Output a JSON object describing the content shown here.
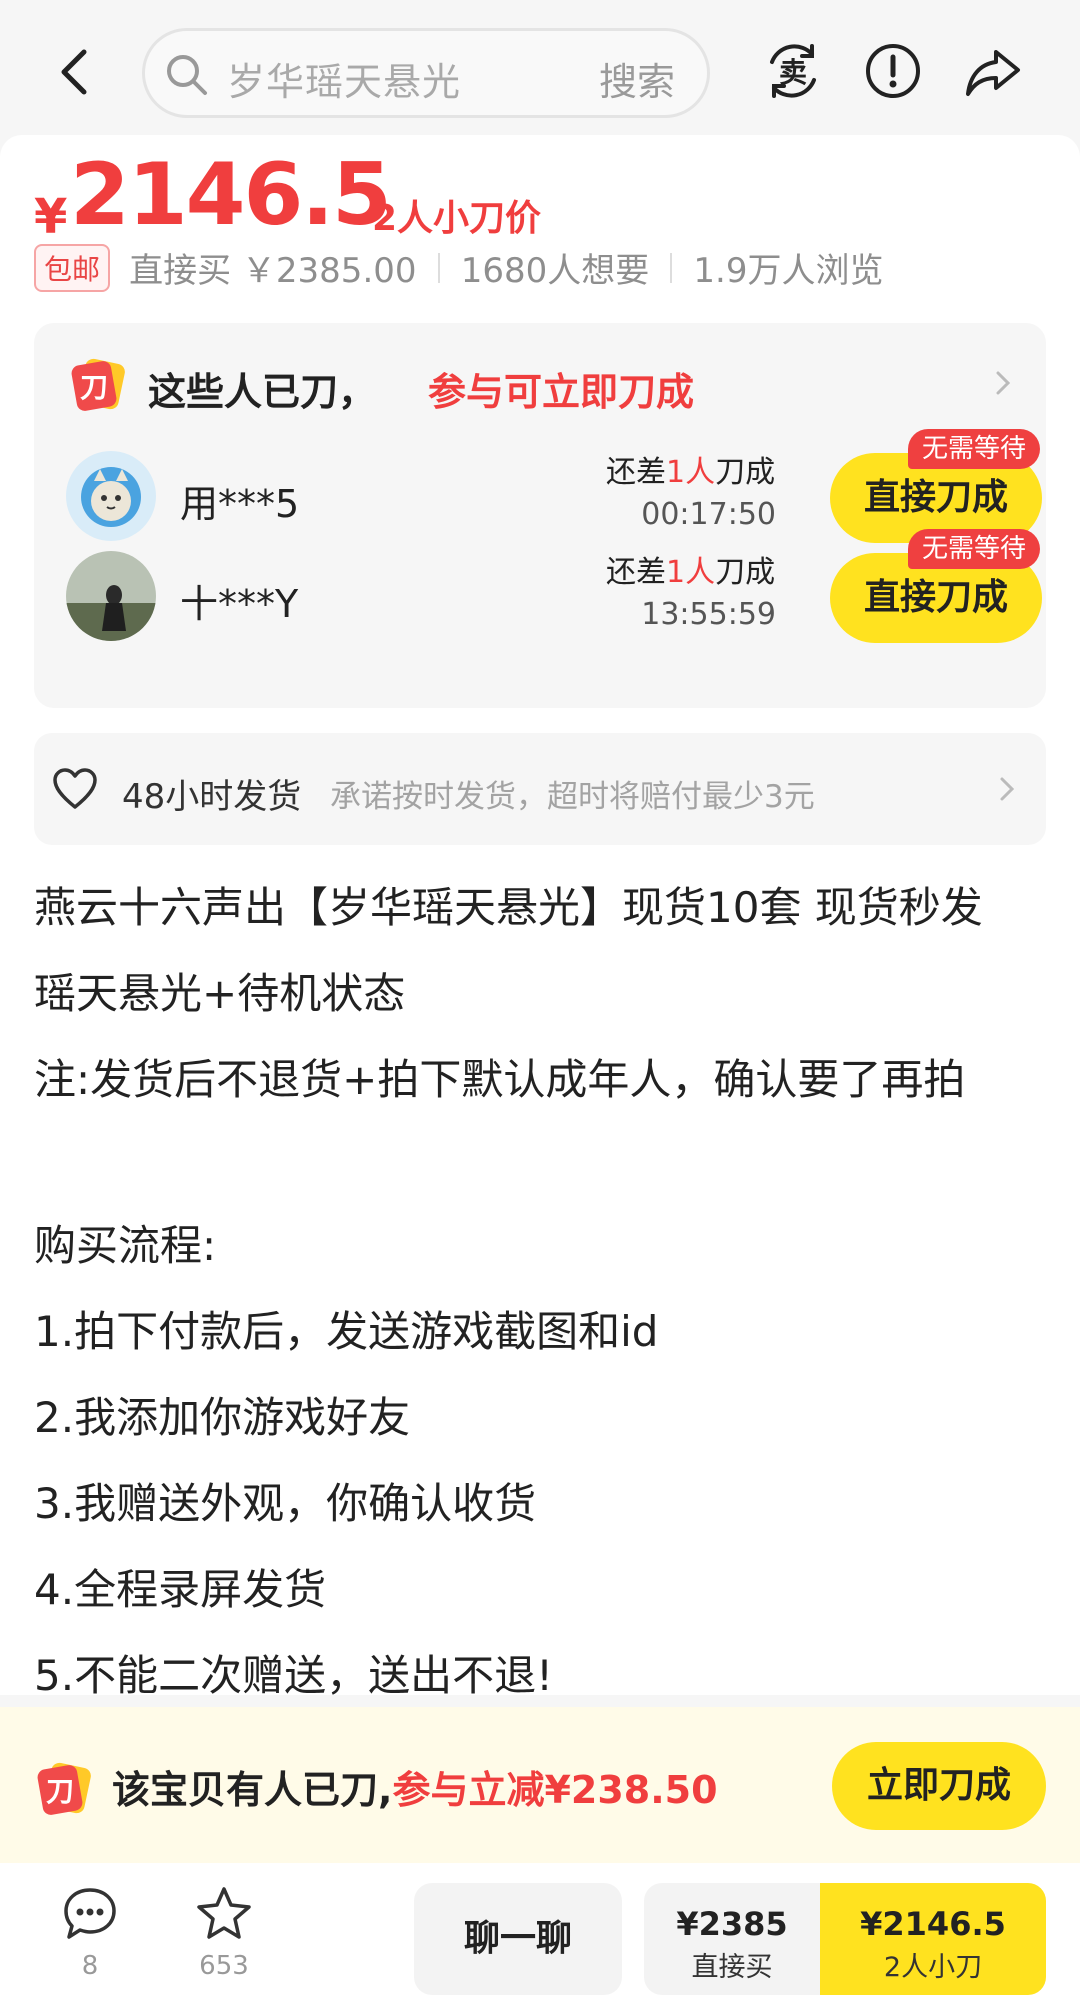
{
  "search": {
    "query": "岁华瑶天悬光",
    "button_label": "搜索"
  },
  "header_icons": [
    "back-arrow-icon",
    "sell-icon",
    "report-icon",
    "share-icon"
  ],
  "price": {
    "currency_symbol": "¥",
    "value": "2146.5",
    "tag": "2人小刀价"
  },
  "meta": {
    "free_shipping": "包邮",
    "direct_buy": "直接买 ￥2385.00",
    "wants": "1680人想要",
    "views": "1.9万人浏览"
  },
  "bargain": {
    "title": "这些人已刀，",
    "title_highlight": "参与可立即刀成",
    "rows": [
      {
        "user": "用***5",
        "status_prefix": "还差",
        "status_count": "1人",
        "status_suffix": "刀成",
        "timer": "00:17:50",
        "badge": "无需等待",
        "button": "直接刀成"
      },
      {
        "user": "十***Y",
        "status_prefix": "还差",
        "status_count": "1人",
        "status_suffix": "刀成",
        "timer": "13:55:59",
        "badge": "无需等待",
        "button": "直接刀成"
      }
    ]
  },
  "shipping": {
    "title": "48小时发货",
    "desc": "承诺按时发货，超时将赔付最少3元"
  },
  "description": [
    "燕云十六声出【岁华瑶天悬光】现货10套 现货秒发",
    "瑶天悬光+待机状态",
    "注:发货后不退货+拍下默认成年人，确认要了再拍",
    "",
    "购买流程:",
    "1.拍下付款后，发送游戏截图和id",
    "2.我添加你游戏好友",
    "3.我赠送外观，你确认收货",
    "4.全程录屏发货",
    "5.不能二次赠送，送出不退!"
  ],
  "promo": {
    "text": "该宝贝有人已刀,",
    "highlight": "参与立减¥238.50",
    "button": "立即刀成"
  },
  "bottom": {
    "comments_count": "8",
    "favorites_count": "653",
    "chat_label": "聊一聊",
    "direct_price": "¥2385",
    "direct_label": "直接买",
    "bargain_price": "¥2146.5",
    "bargain_label": "2人小刀"
  },
  "colors": {
    "accent_red": "#f03e3e",
    "accent_yellow": "#ffe21f"
  }
}
